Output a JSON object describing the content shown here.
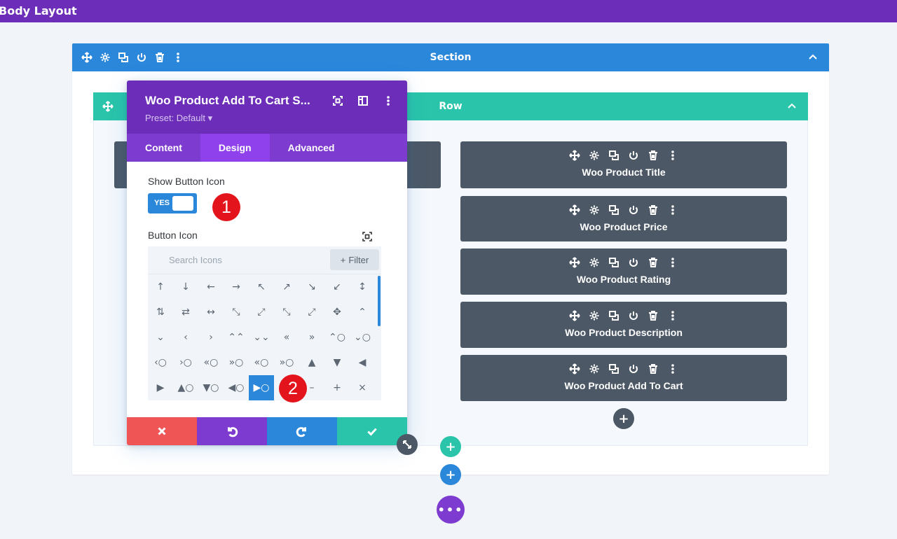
{
  "topbar": {
    "title": "Body Layout"
  },
  "section": {
    "label": "Section"
  },
  "row": {
    "label": "Row"
  },
  "modules": [
    {
      "label": "Woo Product Title"
    },
    {
      "label": "Woo Product Price"
    },
    {
      "label": "Woo Product Rating"
    },
    {
      "label": "Woo Product Description"
    },
    {
      "label": "Woo Product Add To Cart"
    }
  ],
  "panel": {
    "title": "Woo Product Add To Cart S...",
    "preset": "Preset: Default ▾",
    "tabs": [
      {
        "label": "Content",
        "active": false
      },
      {
        "label": "Design",
        "active": true
      },
      {
        "label": "Advanced",
        "active": false
      }
    ],
    "show_button_icon": {
      "label": "Show Button Icon",
      "value": "YES"
    },
    "button_icon": {
      "label": "Button Icon",
      "search_placeholder": "Search Icons",
      "filter_label": "Filter",
      "icons": [
        "↑",
        "↓",
        "←",
        "→",
        "↖",
        "↗",
        "↘",
        "↙",
        "↕",
        "⇅",
        "⇄",
        "↔",
        "⤡",
        "⤢",
        "⤡",
        "⤢",
        "✥",
        "⌃",
        "⌄",
        "‹",
        "›",
        "⌃⌃",
        "⌄⌄",
        "«",
        "»",
        "⌃○",
        "⌄○",
        "‹○",
        "›○",
        "«○",
        "»○",
        "«○",
        "»○",
        "▲",
        "▼",
        "◀",
        "▶",
        "▲○",
        "▼○",
        "◀○",
        "▶○",
        "",
        "–",
        "+",
        "×"
      ],
      "selected_index": 40
    }
  },
  "badges": {
    "one": "1",
    "two": "2"
  },
  "colors": {
    "topbar": "#6c2eb9",
    "section": "#2b87da",
    "row": "#29c4a9",
    "module": "#4c5866",
    "cancel": "#ef5555",
    "undo": "#7e3bd0",
    "redo": "#2b87da",
    "save": "#29c4a9"
  }
}
